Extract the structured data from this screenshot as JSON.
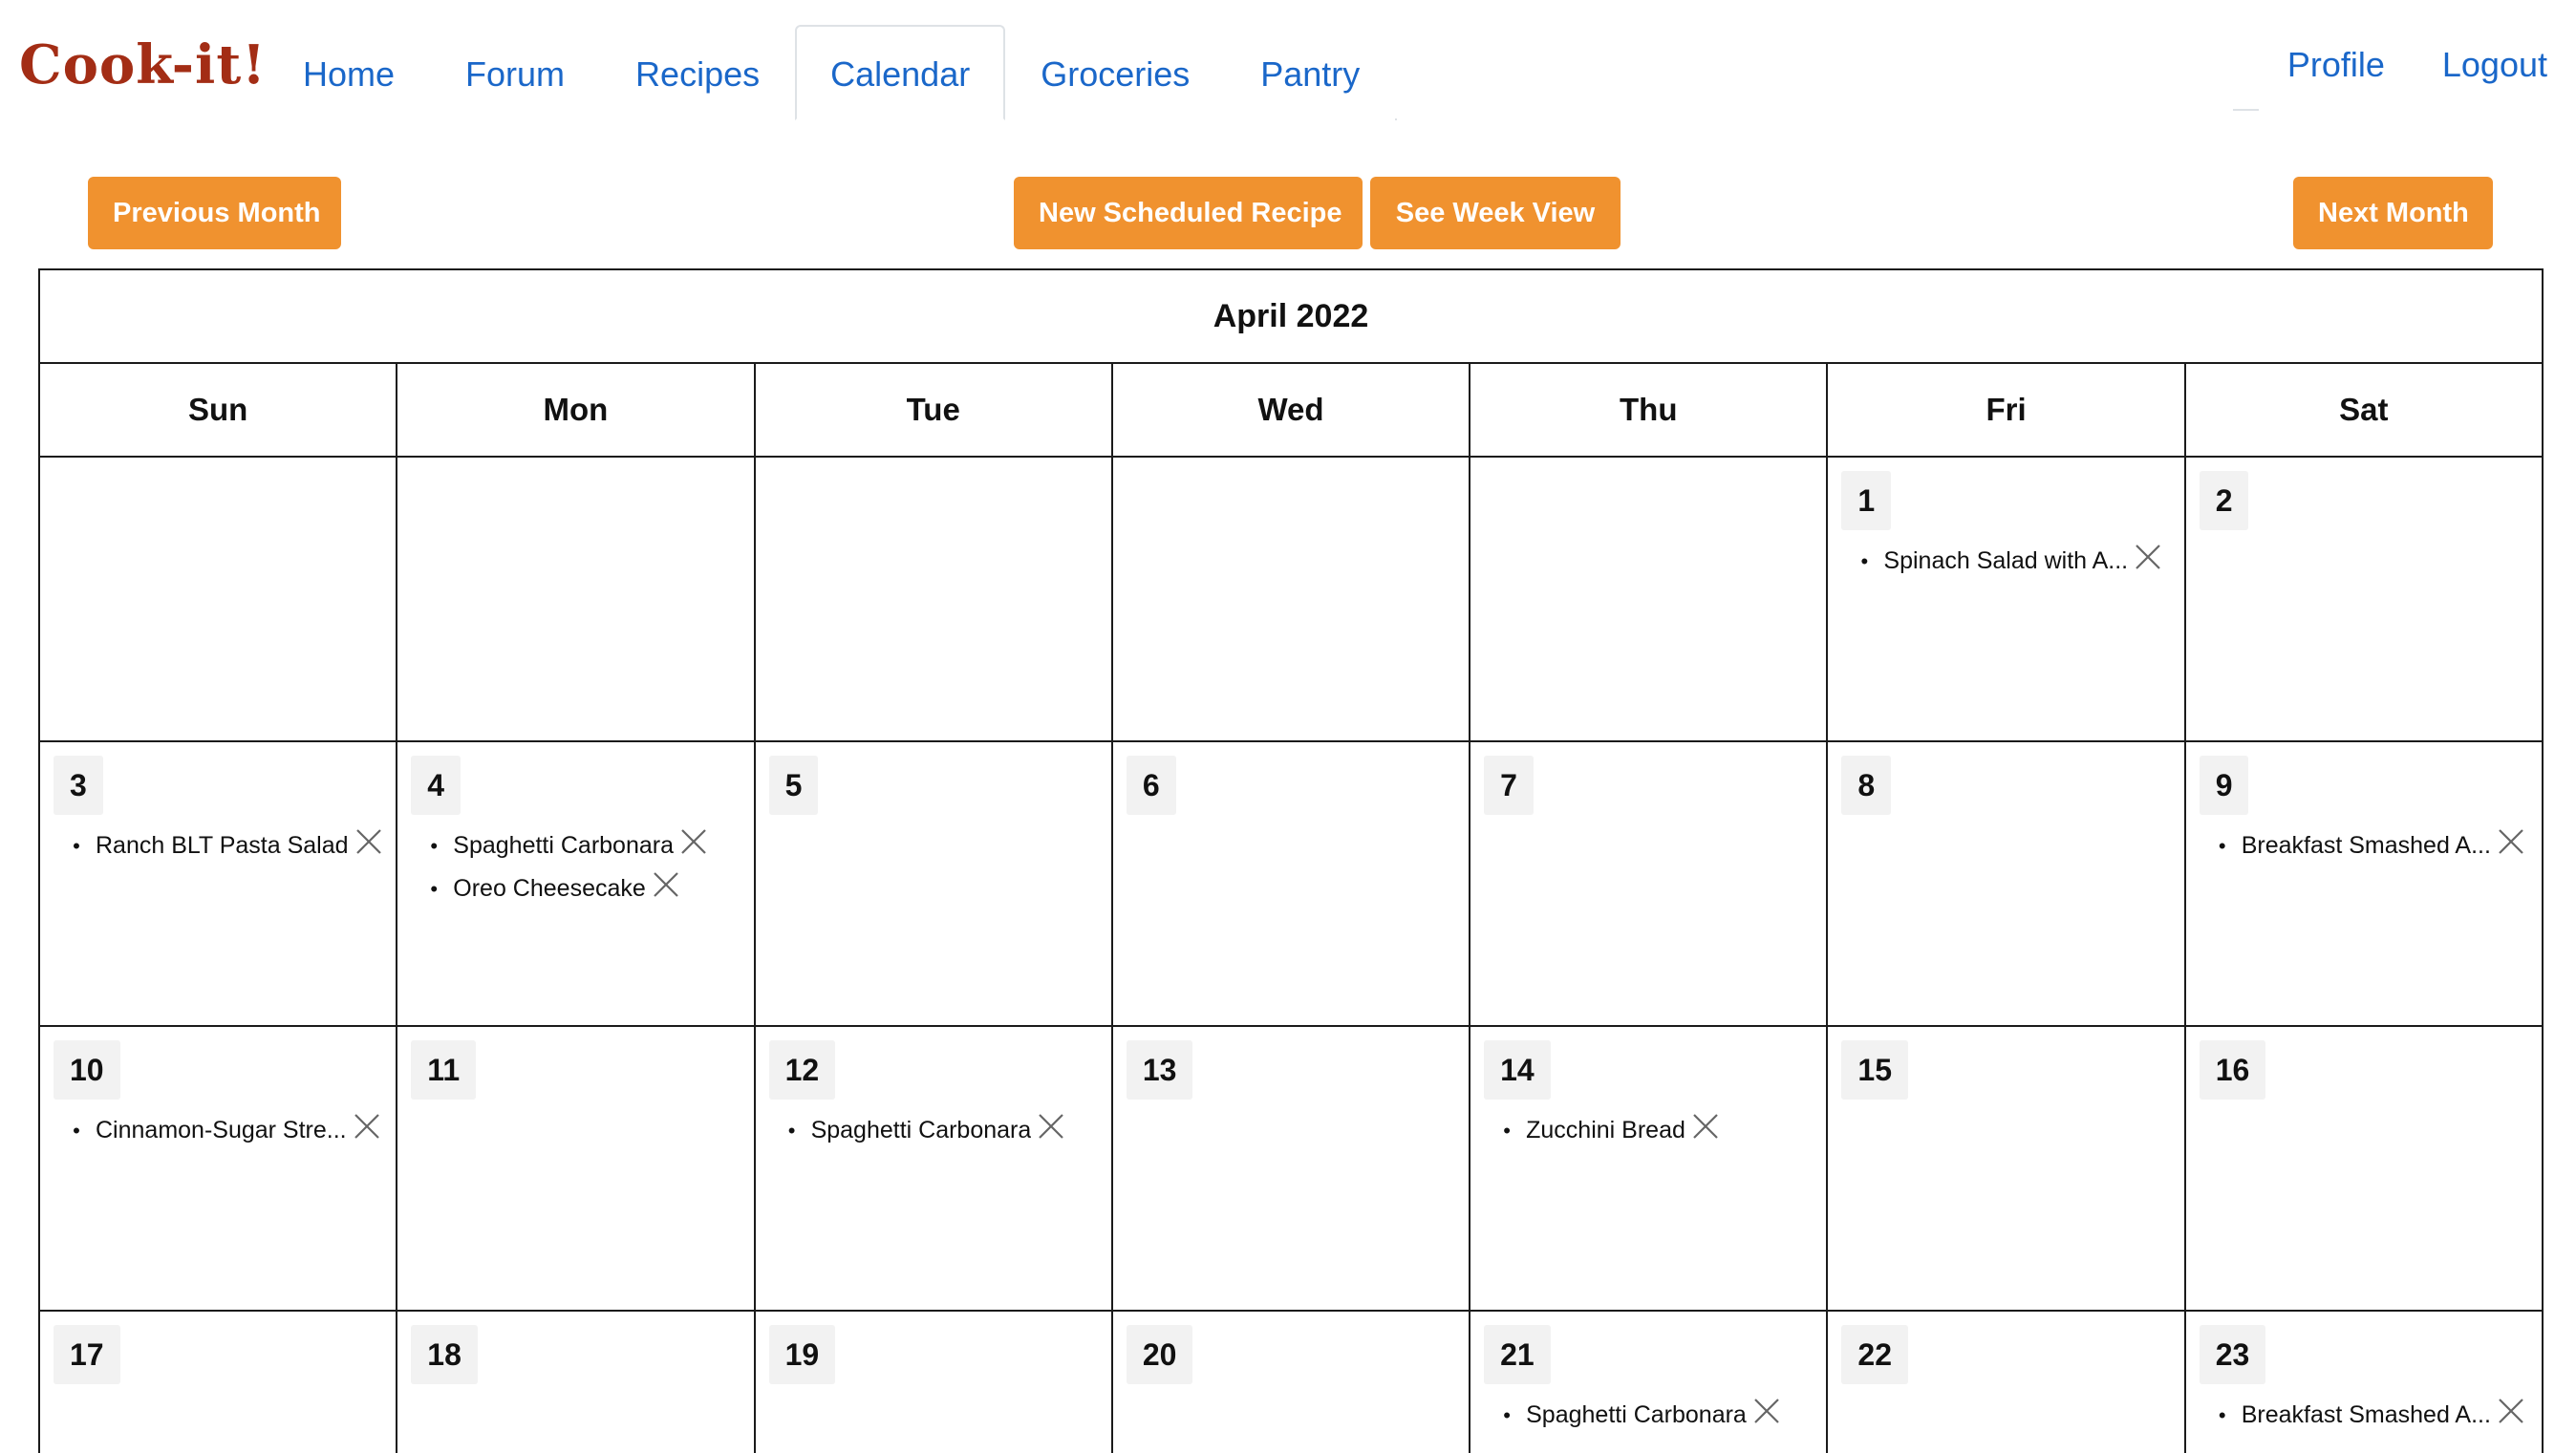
{
  "brand": "Cook-it!",
  "nav": {
    "left": [
      "Home",
      "Forum",
      "Recipes",
      "Calendar",
      "Groceries",
      "Pantry"
    ],
    "active": "Calendar",
    "right": [
      "Profile",
      "Logout"
    ]
  },
  "toolbar": {
    "prev_label": "Previous Month",
    "new_label": "New Scheduled Recipe",
    "week_label": "See Week View",
    "next_label": "Next Month"
  },
  "calendar": {
    "month_title": "April 2022",
    "weekdays": [
      "Sun",
      "Mon",
      "Tue",
      "Wed",
      "Thu",
      "Fri",
      "Sat"
    ],
    "weeks": [
      [
        {
          "day": "",
          "recipes": []
        },
        {
          "day": "",
          "recipes": []
        },
        {
          "day": "",
          "recipes": []
        },
        {
          "day": "",
          "recipes": []
        },
        {
          "day": "",
          "recipes": []
        },
        {
          "day": "1",
          "recipes": [
            "Spinach Salad with A..."
          ]
        },
        {
          "day": "2",
          "recipes": []
        }
      ],
      [
        {
          "day": "3",
          "recipes": [
            "Ranch BLT Pasta Salad"
          ]
        },
        {
          "day": "4",
          "recipes": [
            "Spaghetti Carbonara",
            "Oreo Cheesecake"
          ]
        },
        {
          "day": "5",
          "recipes": []
        },
        {
          "day": "6",
          "recipes": []
        },
        {
          "day": "7",
          "recipes": []
        },
        {
          "day": "8",
          "recipes": []
        },
        {
          "day": "9",
          "recipes": [
            "Breakfast Smashed A..."
          ]
        }
      ],
      [
        {
          "day": "10",
          "recipes": [
            "Cinnamon-Sugar Stre..."
          ]
        },
        {
          "day": "11",
          "recipes": []
        },
        {
          "day": "12",
          "recipes": [
            "Spaghetti Carbonara"
          ]
        },
        {
          "day": "13",
          "recipes": []
        },
        {
          "day": "14",
          "recipes": [
            "Zucchini Bread"
          ]
        },
        {
          "day": "15",
          "recipes": []
        },
        {
          "day": "16",
          "recipes": []
        }
      ],
      [
        {
          "day": "17",
          "recipes": []
        },
        {
          "day": "18",
          "recipes": []
        },
        {
          "day": "19",
          "recipes": []
        },
        {
          "day": "20",
          "recipes": []
        },
        {
          "day": "21",
          "recipes": [
            "Spaghetti Carbonara"
          ]
        },
        {
          "day": "22",
          "recipes": []
        },
        {
          "day": "23",
          "recipes": [
            "Breakfast Smashed A..."
          ]
        }
      ]
    ]
  },
  "colors": {
    "brand": "#a32d15",
    "link": "#1a67c9",
    "button": "#f0922f",
    "day_chip": "#f2f2f2"
  },
  "icons": {
    "remove": "close-x-icon",
    "bullet": "•"
  }
}
